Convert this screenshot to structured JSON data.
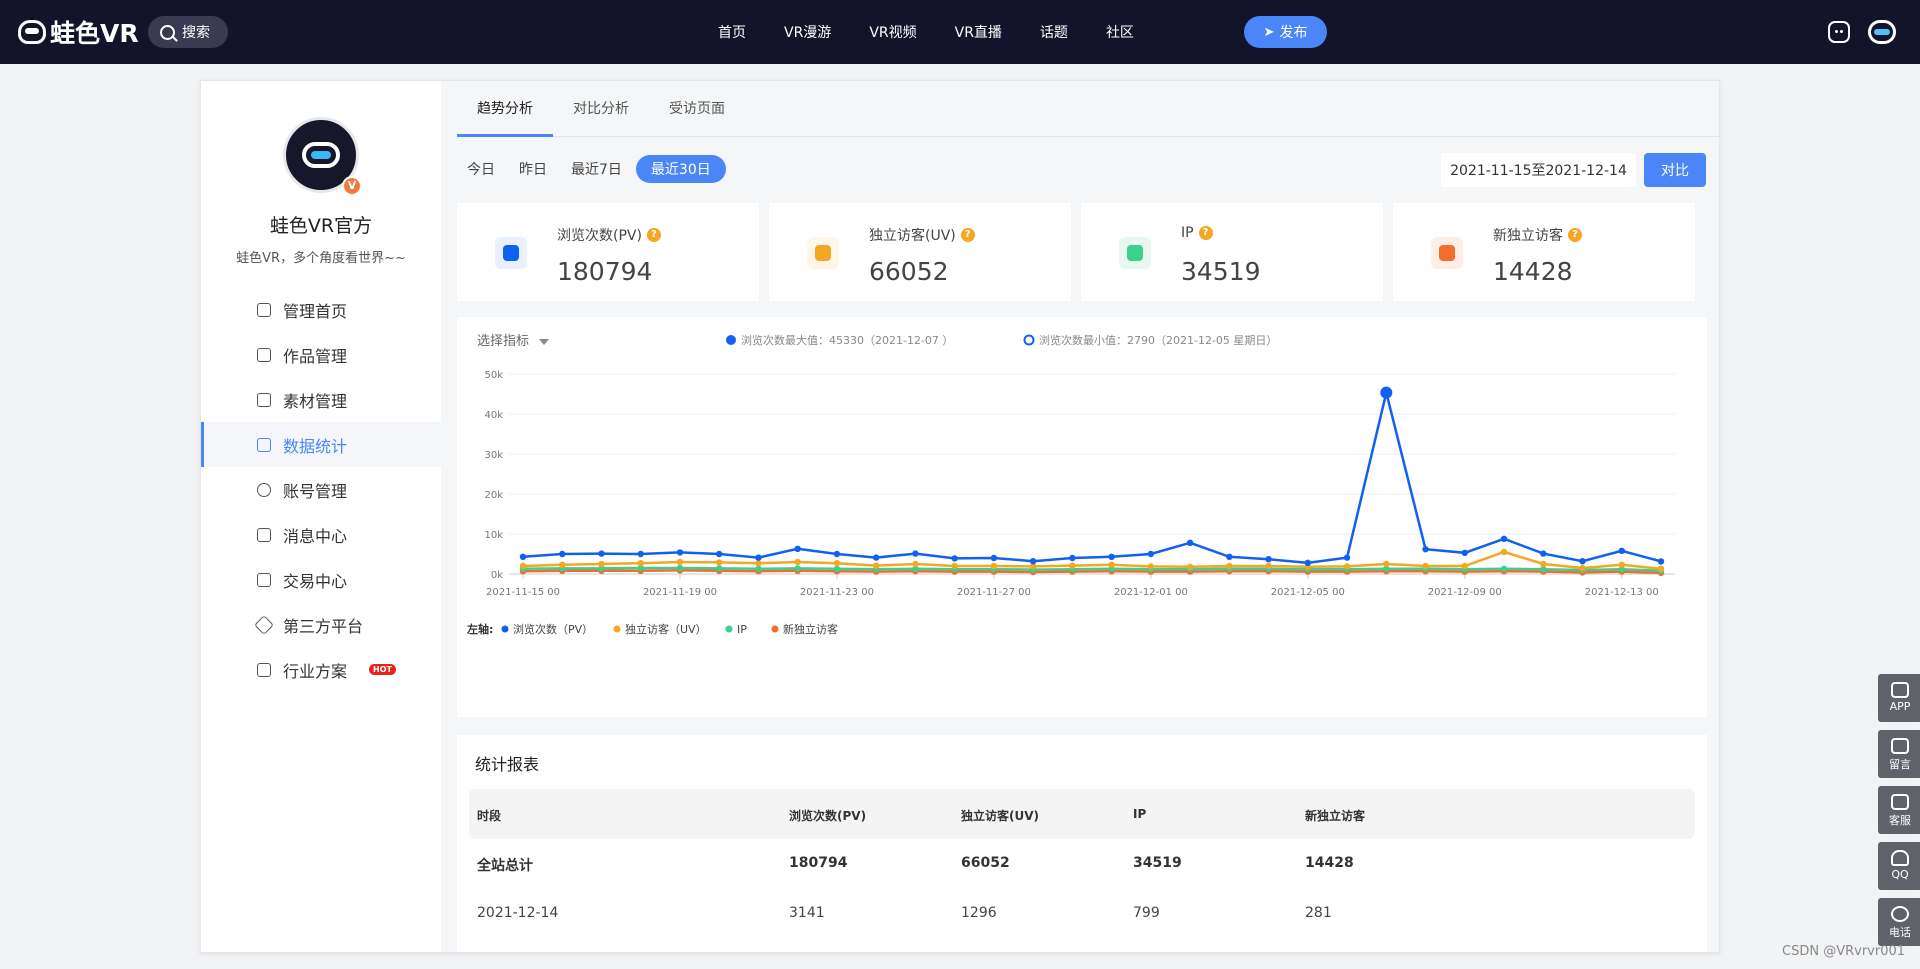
{
  "topbar": {
    "logo": "蛙色VR",
    "search_label": "搜索",
    "nav": [
      "首页",
      "VR漫游",
      "VR视频",
      "VR直播",
      "话题",
      "社区"
    ],
    "publish_label": "发布"
  },
  "profile": {
    "badge": "V",
    "name": "蛙色VR官方",
    "desc": "蛙色VR，多个角度看世界~~"
  },
  "sidebar": {
    "items": [
      {
        "label": "管理首页",
        "icon": "grid-icon"
      },
      {
        "label": "作品管理",
        "icon": "tools-icon"
      },
      {
        "label": "素材管理",
        "icon": "camera-icon"
      },
      {
        "label": "数据统计",
        "icon": "layers-icon",
        "active": true
      },
      {
        "label": "账号管理",
        "icon": "gear-icon"
      },
      {
        "label": "消息中心",
        "icon": "message-icon"
      },
      {
        "label": "交易中心",
        "icon": "receipt-icon"
      },
      {
        "label": "第三方平台",
        "icon": "cube-icon"
      },
      {
        "label": "行业方案",
        "icon": "document-icon"
      }
    ],
    "hot_badge": "HOT"
  },
  "tabs": [
    "趋势分析",
    "对比分析",
    "受访页面"
  ],
  "ranges": [
    "今日",
    "昨日",
    "最近7日",
    "最近30日"
  ],
  "date_range": "2021-11-15至2021-12-14",
  "compare_label": "对比",
  "stats": [
    {
      "label": "浏览次数(PV)",
      "value": "180794",
      "color": "#1061f0",
      "bg": "#eaf1fe"
    },
    {
      "label": "独立访客(UV)",
      "value": "66052",
      "color": "#f5a623",
      "bg": "#fef6e9"
    },
    {
      "label": "IP",
      "value": "34519",
      "color": "#3ccf8e",
      "bg": "#e8f8f1"
    },
    {
      "label": "新独立访客",
      "value": "14428",
      "color": "#f36d30",
      "bg": "#fdeee8"
    }
  ],
  "chart_header": {
    "select_label": "选择指标",
    "max_note": "浏览次数最大值：45330（2021-12-07 ）",
    "min_note": "浏览次数最小值：2790（2021-12-05 星期日）",
    "legend_prefix": "左轴:"
  },
  "chart_data": {
    "type": "line",
    "x": [
      "2021-11-15",
      "2021-11-16",
      "2021-11-17",
      "2021-11-18",
      "2021-11-19",
      "2021-11-20",
      "2021-11-21",
      "2021-11-22",
      "2021-11-23",
      "2021-11-24",
      "2021-11-25",
      "2021-11-26",
      "2021-11-27",
      "2021-11-28",
      "2021-11-29",
      "2021-11-30",
      "2021-12-01",
      "2021-12-02",
      "2021-12-03",
      "2021-12-04",
      "2021-12-05",
      "2021-12-06",
      "2021-12-07",
      "2021-12-08",
      "2021-12-09",
      "2021-12-10",
      "2021-12-11",
      "2021-12-12",
      "2021-12-13",
      "2021-12-14"
    ],
    "xticks": [
      "2021-11-15 00",
      "2021-11-19 00",
      "2021-11-23 00",
      "2021-11-27 00",
      "2021-12-01 00",
      "2021-12-05 00",
      "2021-12-09 00",
      "2021-12-13 00"
    ],
    "yticks": [
      "0k",
      "10k",
      "20k",
      "30k",
      "40k",
      "50k"
    ],
    "ylim": [
      0,
      50000
    ],
    "series": [
      {
        "name": "浏览次数（PV）",
        "color": "#1061f0",
        "values": [
          4300,
          5000,
          5100,
          5000,
          5400,
          5000,
          4100,
          6300,
          5000,
          4100,
          5100,
          3900,
          4000,
          3200,
          4000,
          4300,
          5000,
          7800,
          4300,
          3700,
          2790,
          4100,
          45330,
          6200,
          5300,
          8800,
          5100,
          3200,
          5800,
          3141
        ]
      },
      {
        "name": "独立访客（UV）",
        "color": "#f5a623",
        "values": [
          2000,
          2300,
          2500,
          2700,
          3000,
          2900,
          2700,
          3000,
          2700,
          2100,
          2500,
          2000,
          2000,
          1900,
          2100,
          2300,
          1900,
          1800,
          2000,
          2000,
          1800,
          1900,
          2500,
          2000,
          2000,
          5500,
          2500,
          1500,
          2300,
          1296
        ]
      },
      {
        "name": "IP",
        "color": "#3ccf8e",
        "values": [
          1300,
          1400,
          1400,
          1500,
          1500,
          1400,
          1300,
          1400,
          1300,
          1200,
          1300,
          1200,
          1200,
          1100,
          1200,
          1300,
          1200,
          1200,
          1300,
          1300,
          1200,
          1200,
          1300,
          1300,
          1200,
          1300,
          1200,
          1000,
          1200,
          799
        ]
      },
      {
        "name": "新独立访客",
        "color": "#f36d30",
        "values": [
          700,
          800,
          800,
          800,
          900,
          800,
          700,
          800,
          700,
          600,
          700,
          600,
          600,
          500,
          600,
          700,
          600,
          600,
          700,
          700,
          600,
          600,
          700,
          700,
          600,
          700,
          600,
          400,
          600,
          281
        ]
      }
    ]
  },
  "report": {
    "title": "统计报表",
    "headers": [
      "时段",
      "浏览次数(PV)",
      "独立访客(UV)",
      "IP",
      "新独立访客"
    ],
    "rows": [
      [
        "全站总计",
        "180794",
        "66052",
        "34519",
        "14428"
      ],
      [
        "2021-12-14",
        "3141",
        "1296",
        "799",
        "281"
      ]
    ]
  },
  "side_tools": [
    "APP",
    "留言",
    "客服",
    "QQ",
    "电话"
  ],
  "watermark": "CSDN @VRvrvr001"
}
